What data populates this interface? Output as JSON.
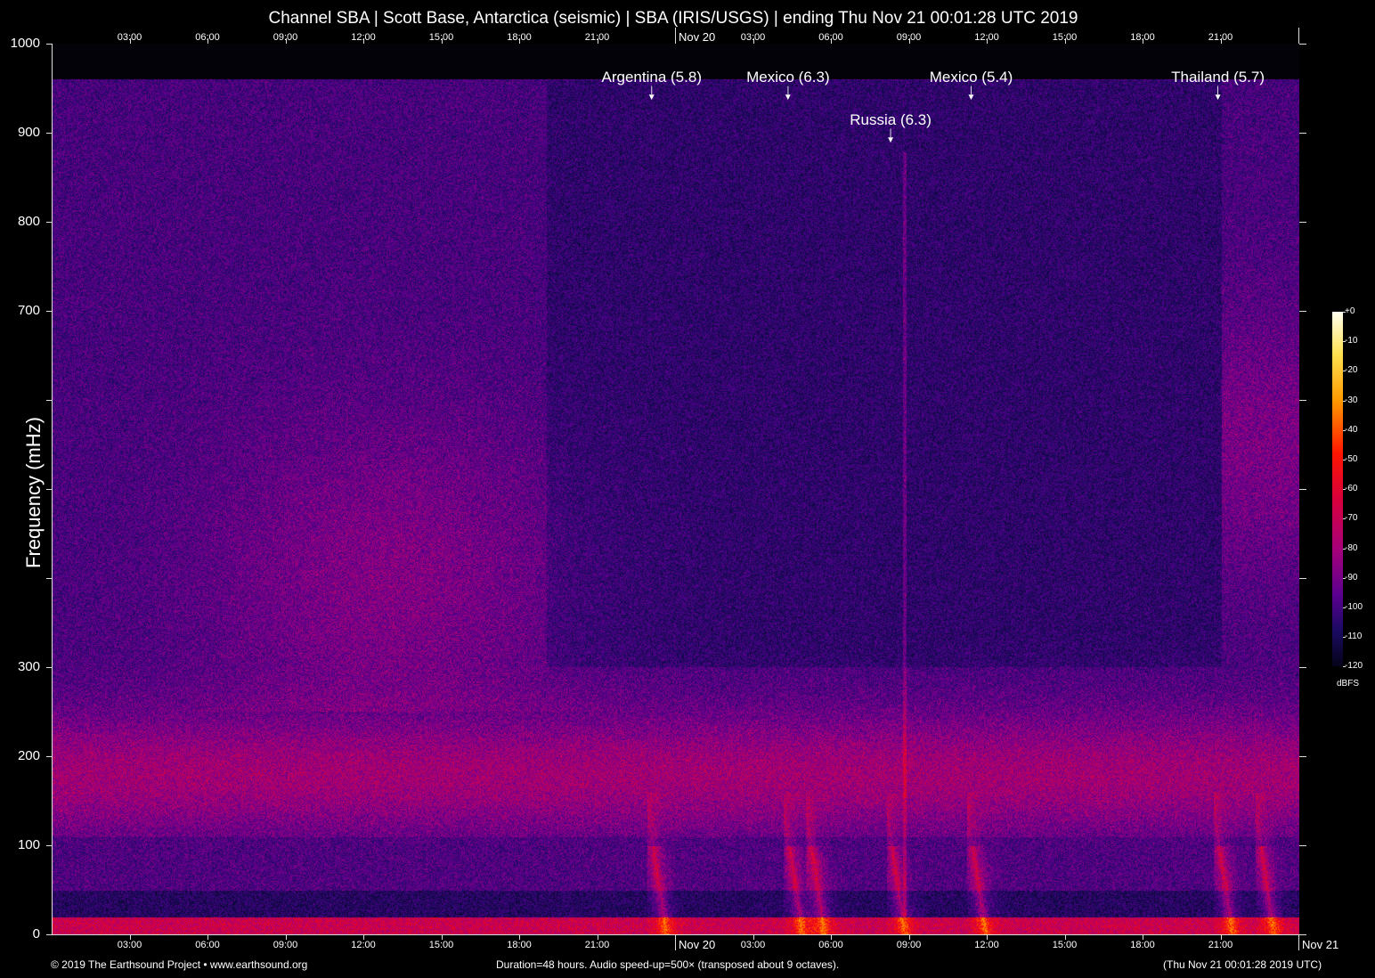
{
  "title": "Channel SBA | Scott Base, Antarctica (seismic) | SBA (IRIS/USGS) | ending Thu Nov 21 00:01:28 UTC 2019",
  "chart_data": {
    "type": "heatmap",
    "title": "Channel SBA | Scott Base, Antarctica (seismic) | SBA (IRIS/USGS) | ending Thu Nov 21 00:01:28 UTC 2019",
    "ylabel": "Frequency (mHz)",
    "ylim": [
      0,
      1000
    ],
    "xlim_hours": [
      0,
      48
    ],
    "y_ticks": [
      0,
      100,
      200,
      300,
      400,
      500,
      600,
      700,
      800,
      900,
      1000
    ],
    "y_tick_labels": [
      "0",
      "100",
      "200",
      "300",
      "",
      "",
      "",
      "700",
      "800",
      "900",
      "1000"
    ],
    "x_ticks": [
      {
        "h": 3,
        "label": "03:00"
      },
      {
        "h": 6,
        "label": "06:00"
      },
      {
        "h": 9,
        "label": "09:00"
      },
      {
        "h": 12,
        "label": "12:00"
      },
      {
        "h": 15,
        "label": "15:00"
      },
      {
        "h": 18,
        "label": "18:00"
      },
      {
        "h": 21,
        "label": "21:00"
      },
      {
        "h": 24,
        "label": "Nov 20",
        "day": true
      },
      {
        "h": 27,
        "label": "03:00"
      },
      {
        "h": 30,
        "label": "06:00"
      },
      {
        "h": 33,
        "label": "09:00"
      },
      {
        "h": 36,
        "label": "12:00"
      },
      {
        "h": 39,
        "label": "15:00"
      },
      {
        "h": 42,
        "label": "18:00"
      },
      {
        "h": 45,
        "label": "21:00"
      }
    ],
    "x_end_label": "Nov 21",
    "events": [
      {
        "label": "Argentina (5.8)",
        "h": 23.1,
        "row": 0
      },
      {
        "label": "Mexico (6.3)",
        "h": 28.35,
        "row": 0
      },
      {
        "label": "Russia (6.3)",
        "h": 32.3,
        "row": 1
      },
      {
        "label": "Mexico (5.4)",
        "h": 35.4,
        "row": 0
      },
      {
        "label": "Thailand (5.7)",
        "h": 44.9,
        "row": 0
      }
    ],
    "colorbar": {
      "label": "dBFS",
      "ticks": [
        "+0",
        "-10",
        "-20",
        "-30",
        "-40",
        "-50",
        "-60",
        "-70",
        "-80",
        "-90",
        "-100",
        "-110",
        "-120"
      ],
      "range": [
        -120,
        0
      ]
    }
  },
  "footer": {
    "left": "© 2019 The Earthsound Project • www.earthsound.org",
    "center": "Duration=48 hours. Audio speed-up=500× (transposed about 9 octaves).",
    "right": "(Thu Nov 21 00:01:28 2019 UTC)"
  }
}
